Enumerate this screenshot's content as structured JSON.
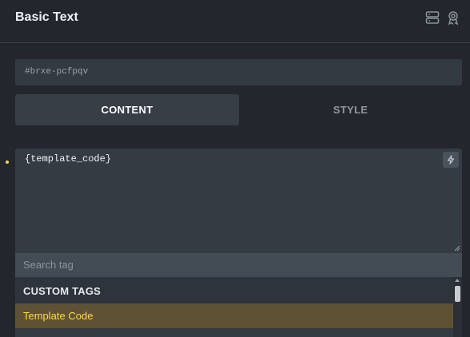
{
  "panel": {
    "title": "Basic Text"
  },
  "element": {
    "id": "#brxe-pcfpqv"
  },
  "tabs": [
    {
      "label": "CONTENT",
      "active": true
    },
    {
      "label": "STYLE",
      "active": false
    }
  ],
  "editor": {
    "value": "{template_code}"
  },
  "search": {
    "placeholder": "Search tag"
  },
  "dropdown": {
    "group_label": "CUSTOM TAGS",
    "items": [
      {
        "label": "Template Code",
        "highlighted": true
      }
    ]
  },
  "icons": {
    "header": [
      "server-icon",
      "badge-icon"
    ],
    "editor": "bolt-icon"
  },
  "colors": {
    "accent": "#ffd64f",
    "background": "#23272d",
    "highlight": "#5f5234"
  }
}
